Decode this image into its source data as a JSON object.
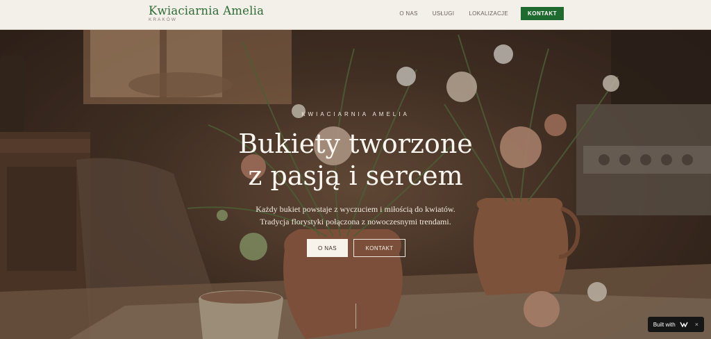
{
  "header": {
    "brand_name": "Kwiaciarnia Amelia",
    "brand_subtitle": "KRAKÓW",
    "nav_items": [
      "O NAS",
      "USŁUGI",
      "LOKALIZACJE"
    ],
    "cta_label": "KONTAKT"
  },
  "hero": {
    "eyebrow": "KWIACIARNIA AMELIA",
    "headline_line1": "Bukiety tworzone",
    "headline_line2": "z pasją i sercem",
    "sub_line1": "Każdy bukiet powstaje z wyczuciem i miłością do kwiatów.",
    "sub_line2": "Tradycja florystyki połączona z nowoczesnymi trendami.",
    "button_primary": "O NAS",
    "button_secondary": "KONTAKT"
  },
  "badge": {
    "label": "Built with",
    "logo_icon": "brand-logo-icon",
    "close": "×"
  },
  "colors": {
    "header_bg": "#f3efe9",
    "brand_green": "#2f6b35",
    "cta_green": "#1f6a2f"
  }
}
